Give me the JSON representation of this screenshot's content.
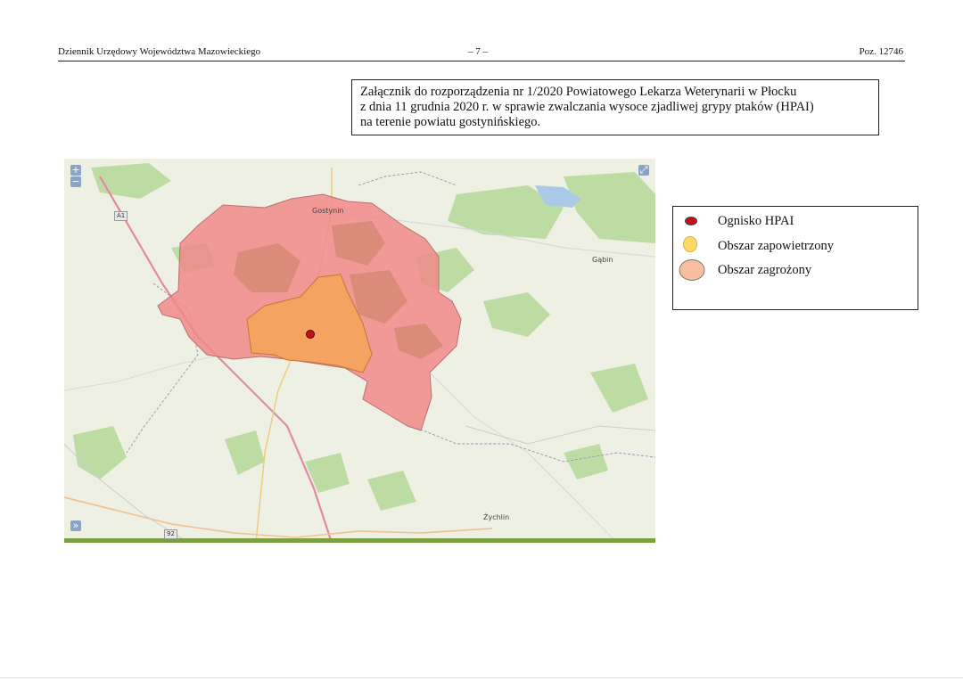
{
  "header": {
    "left": "Dziennik Urzędowy Województwa Mazowieckiego",
    "center": "– 7 –",
    "right": "Poz. 12746"
  },
  "annex": {
    "line1": "Załącznik do rozporządzenia nr 1/2020 Powiatowego Lekarza Weterynarii w Płocku",
    "line2": "z dnia 11 grudnia 2020 r. w sprawie zwalczania wysoce zjadliwej grypy ptaków (HPAI)",
    "line3": "na terenie powiatu gostynińskiego."
  },
  "map": {
    "zoom_in": "+",
    "zoom_out": "−",
    "fullscreen": "⤢",
    "layers_toggle": "»",
    "places": {
      "gostynin": "Gostynin",
      "gabin": "Gąbin",
      "zychlin": "Żychlin"
    },
    "roads": {
      "a1": "A1",
      "r92": "92"
    },
    "colors": {
      "threatened_zone": "#f08a8a",
      "infected_zone": "#f4a261",
      "outbreak": "#c0101a",
      "forest": "#b9dca0",
      "lake": "#aac9e6"
    }
  },
  "legend": {
    "items": [
      {
        "label": "Ognisko HPAI",
        "color": "#c0101a"
      },
      {
        "label": "Obszar zapowietrzony",
        "color": "#ffd966"
      },
      {
        "label": "Obszar zagrożony",
        "color": "#f7bfa0"
      }
    ]
  }
}
